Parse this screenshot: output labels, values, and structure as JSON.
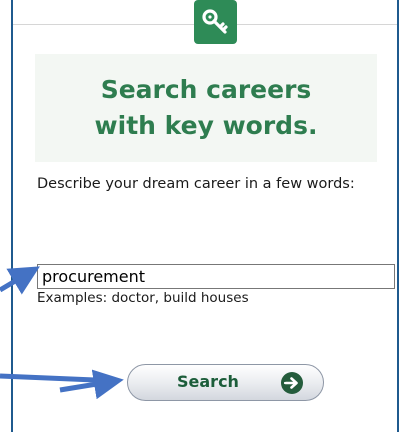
{
  "heading": {
    "line1": "Search careers",
    "line2": "with key words."
  },
  "prompt": "Describe your dream career in a few words:",
  "search": {
    "value": "procurement",
    "examples": "Examples: doctor, build houses"
  },
  "button": {
    "label": "Search",
    "icon": "arrow-circle-right-icon"
  },
  "colors": {
    "brand_green": "#2e8b57",
    "heading_green": "#2e7d4f",
    "annotation_arrow": "#4472c4",
    "frame_blue": "#1f5a8e"
  }
}
